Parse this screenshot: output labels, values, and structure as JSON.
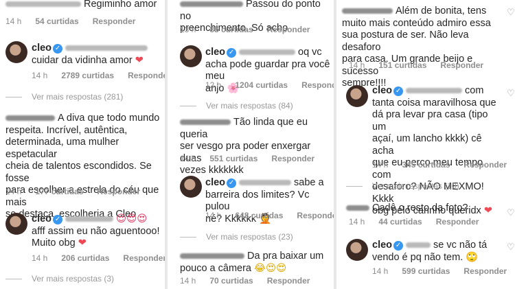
{
  "columns": [
    {
      "items": [
        {
          "kind": "meta",
          "time": "14 h",
          "likes": "54 curtidas",
          "reply": "Responder",
          "prefix_text": "Regiminho amor"
        },
        {
          "kind": "reply",
          "user": "cleo",
          "text": "cuidar da vidinha amor",
          "emoji": "❤",
          "time": "14 h",
          "likes": "2789 curtidas",
          "reply": "Responder"
        },
        {
          "kind": "more",
          "label": "Ver mais respostas (281)"
        },
        {
          "kind": "comment",
          "lines": [
            "A diva que todo mundo",
            "respeita. Incrível, autêntica,",
            "determinada, uma mulher espetacular",
            "cheia de talentos escondidos.  Se fosse",
            "para escolher a estrela do céu que mais",
            "se destaca, escolheria a Cleo"
          ],
          "time": "14 h",
          "likes": "177 curtidas",
          "reply": "Responder"
        },
        {
          "kind": "reply",
          "user": "cleo",
          "text": "afff assim eu não aguentooo!",
          "text2": "Muito obg",
          "emoji_top": "😍😍😍",
          "emoji": "❤",
          "time": "14 h",
          "likes": "206 curtidas",
          "reply": "Responder"
        },
        {
          "kind": "more",
          "label": "Ver mais respostas (3)"
        }
      ]
    },
    {
      "items": [
        {
          "kind": "comment",
          "lines": [
            "Passou do ponto no",
            "preenchimento. Só acho"
          ],
          "time": "13 h",
          "likes": "85 curtidas",
          "reply": "Responder"
        },
        {
          "kind": "reply",
          "user": "cleo",
          "inline_tail": "oq vc",
          "text": "acha pode guardar pra você meu",
          "text2": "anjo",
          "emoji": "🌸",
          "time": "12 h",
          "likes": "1204 curtidas",
          "reply": "Responder"
        },
        {
          "kind": "more",
          "label": "Ver mais respostas (84)"
        },
        {
          "kind": "comment",
          "lines": [
            "Tão linda que eu queria",
            "ser vesgo pra poder enxergar duas",
            "vezes kkkkkkk"
          ],
          "time": "14 h",
          "likes": "551 curtidas",
          "reply": "Responder"
        },
        {
          "kind": "reply",
          "user": "cleo",
          "inline_tail": "sabe a",
          "text": "barreira dos limites? Vc pulou",
          "text2": "né? Kkkkkk",
          "emoji": "🤦",
          "time": "14 h",
          "likes": "648 curtidas",
          "reply": "Responder"
        },
        {
          "kind": "more",
          "label": "Ver mais respostas (23)"
        },
        {
          "kind": "comment",
          "lines": [
            "Da pra baixar um",
            "pouco a câmera"
          ],
          "emoji": "😂😍😍",
          "time": "14 h",
          "likes": "70 curtidas",
          "reply": "Responder"
        }
      ]
    },
    {
      "items": [
        {
          "kind": "comment",
          "lines": [
            "Além de bonita, tens",
            "muito mais conteúdo admiro essa",
            "sua postura de ser. Não leva desaforo",
            "para casa.  Um grande beijo e sucesso",
            "sempre!!!!"
          ],
          "time": "14 h",
          "likes": "151 curtidas",
          "reply": "Responder"
        },
        {
          "kind": "reply",
          "user": "cleo",
          "inline_tail": "com",
          "lines": [
            "tanta coisa maravilhosa que",
            "dá pra levar pra casa (tipo um",
            "açaí, um lancho kkkk) cê acha",
            "que eu perco meu tempo com",
            "desaforo? NÃO MEXMO! Kkkk",
            "obg pelo carinho queridx"
          ],
          "emoji": "❤",
          "time": "14 h",
          "likes": "345 curtidas",
          "reply": "Responder"
        },
        {
          "kind": "more",
          "label": "Ver mais respostas (10)"
        },
        {
          "kind": "comment",
          "lines": [
            "Cadê o resto da foto?"
          ],
          "time": "14 h",
          "likes": "44 curtidas",
          "reply": "Responder"
        },
        {
          "kind": "reply",
          "user": "cleo",
          "inline_tail": "se vc não tá",
          "text": "vendo é pq não tem.",
          "emoji": "🙄",
          "time": "14 h",
          "likes": "599 curtidas",
          "reply": "Responder"
        }
      ]
    }
  ]
}
